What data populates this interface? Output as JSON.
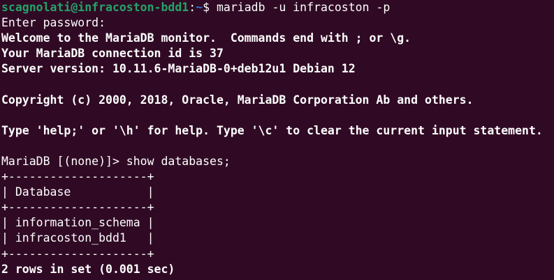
{
  "prompt": {
    "user_host": "scagnolati@infracoston-bdd1",
    "separator": ":",
    "path": "~",
    "symbol": "$ ",
    "command": "mariadb -u infracoston -p"
  },
  "lines": {
    "enter_password": "Enter password:",
    "welcome": "Welcome to the MariaDB monitor.  Commands end with ; or \\g.",
    "connection_id": "Your MariaDB connection id is 37",
    "server_version": "Server version: 10.11.6-MariaDB-0+deb12u1 Debian 12",
    "copyright": "Copyright (c) 2000, 2018, Oracle, MariaDB Corporation Ab and others.",
    "help": "Type 'help;' or '\\h' for help. Type '\\c' to clear the current input statement.",
    "mariadb_prompt": "MariaDB [(none)]> show databases;"
  },
  "table": {
    "border_top": "+--------------------+",
    "header": "| Database           |",
    "border_mid": "+--------------------+",
    "rows": [
      "| information_schema |",
      "| infracoston_bdd1   |"
    ],
    "border_bottom": "+--------------------+"
  },
  "result": "2 rows in set (0.001 sec)",
  "colors": {
    "background": "#300a24",
    "prompt_user": "#26a269",
    "prompt_path": "#2a7bde",
    "text": "#ffffff"
  }
}
